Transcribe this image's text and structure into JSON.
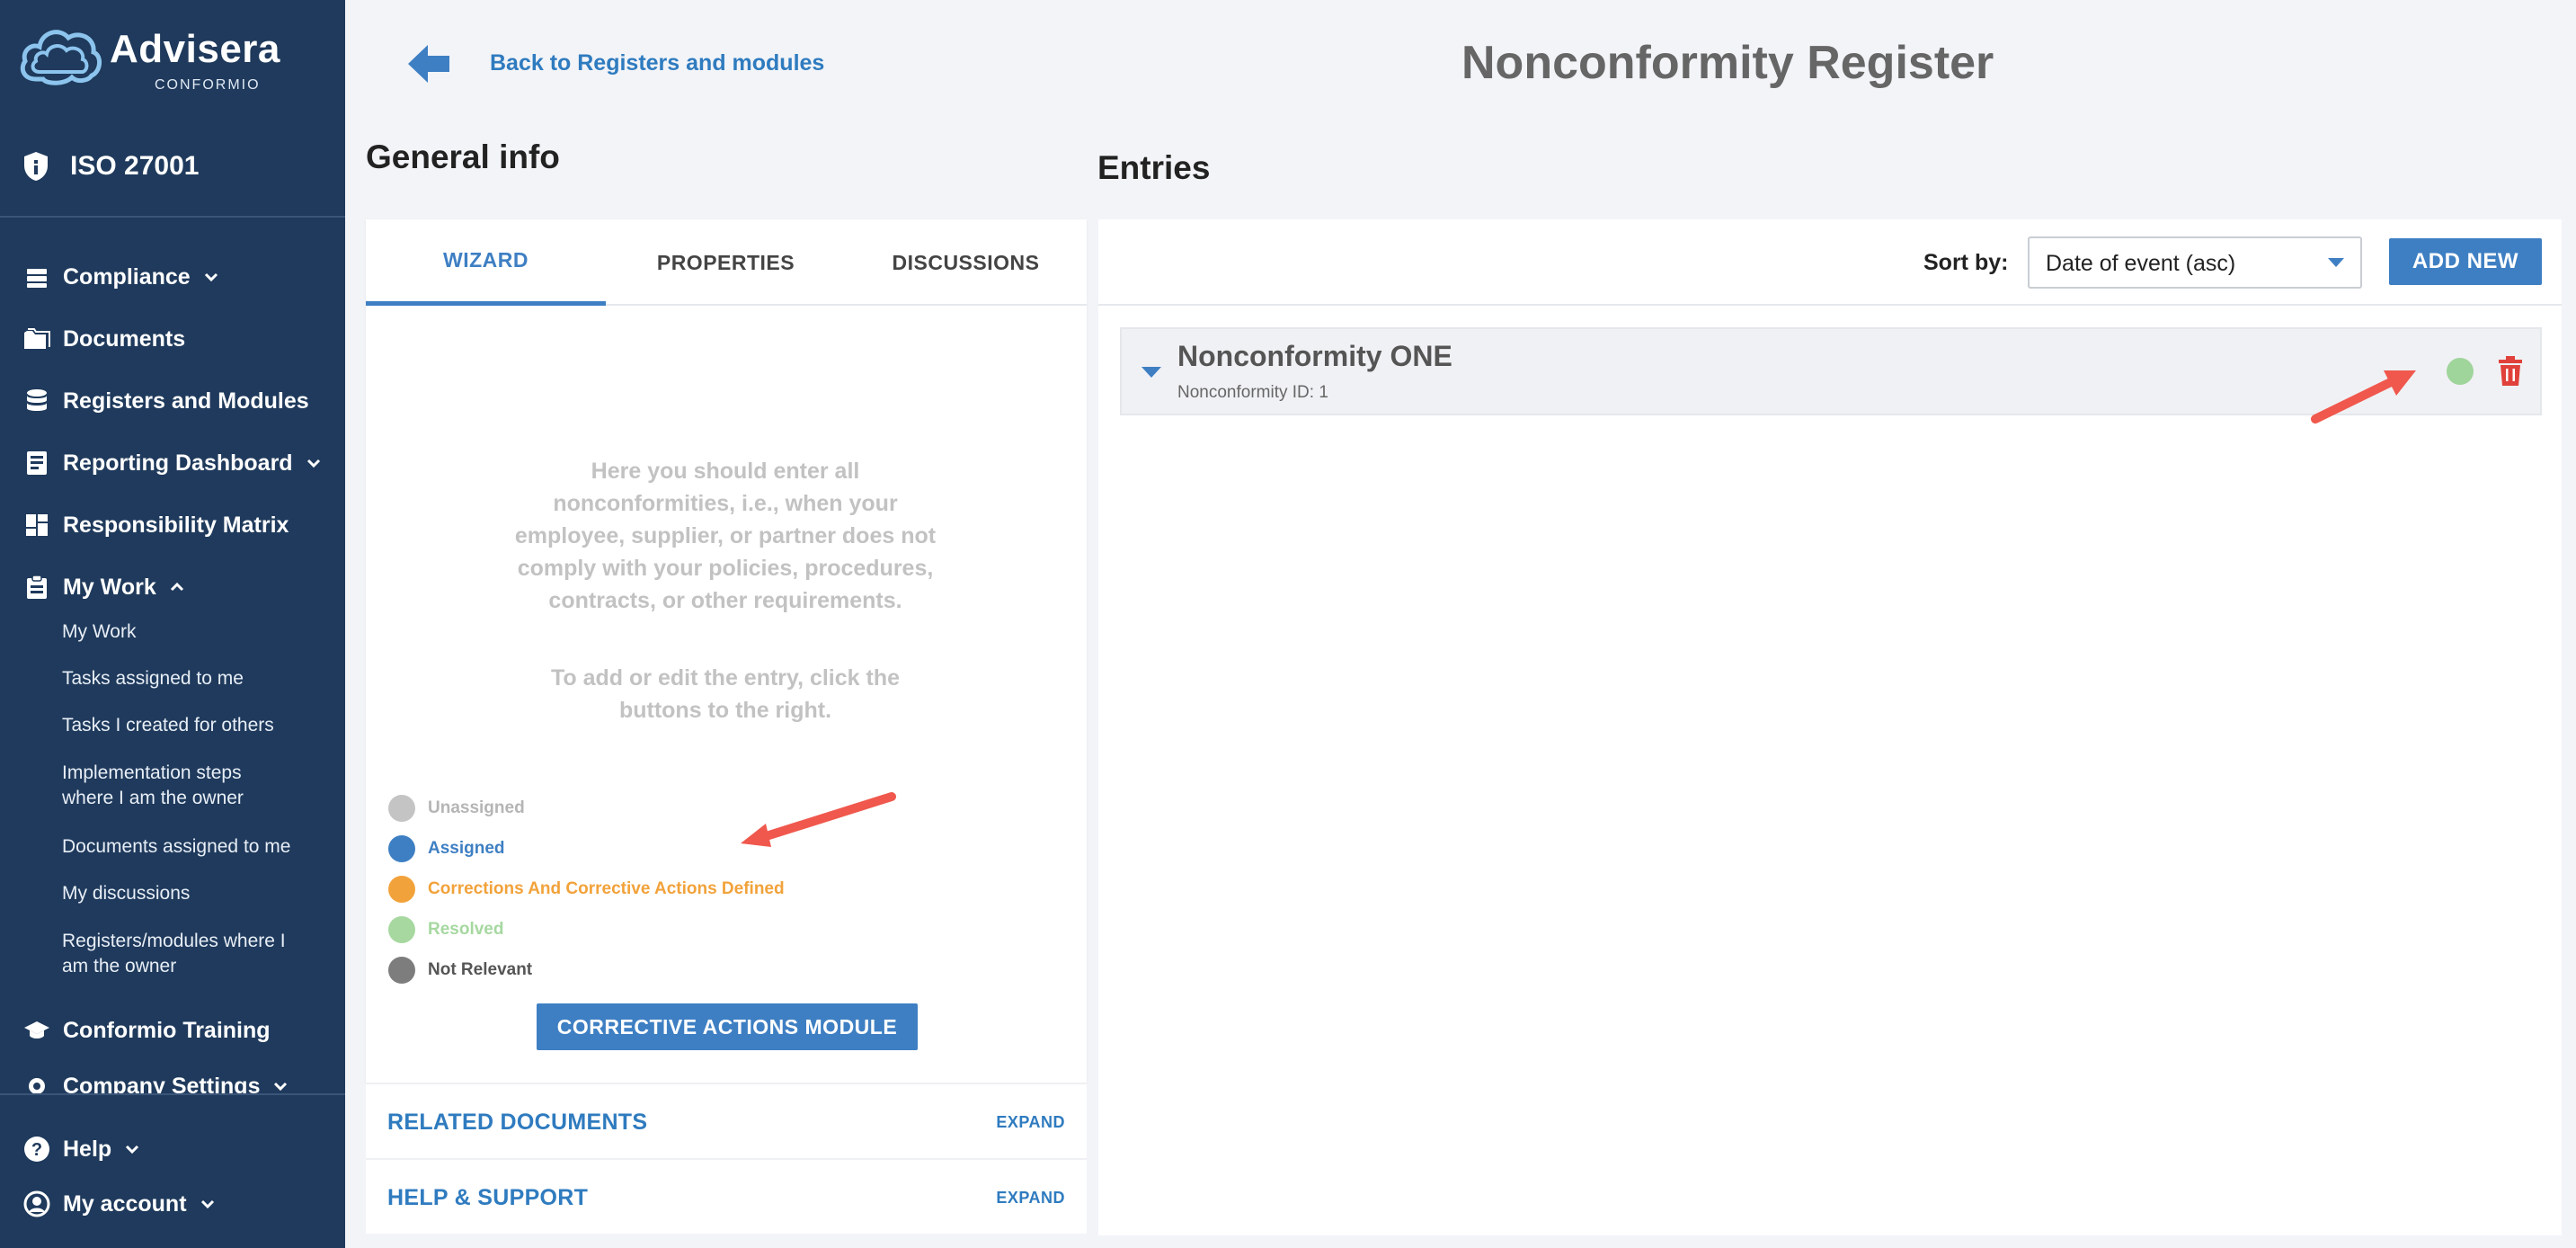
{
  "brand": {
    "name": "Advisera",
    "sub": "CONFORMIO"
  },
  "project": {
    "label": "ISO 27001"
  },
  "nav": {
    "compliance": "Compliance",
    "documents": "Documents",
    "registers": "Registers and Modules",
    "reporting": "Reporting Dashboard",
    "responsibility": "Responsibility Matrix",
    "my_work": "My Work",
    "sub_items": [
      "My Work",
      "Tasks assigned to me",
      "Tasks I created for others",
      "Implementation steps where I am the owner",
      "Documents assigned to me",
      "My discussions",
      "Registers/modules where I am the owner"
    ],
    "training": "Conformio Training",
    "company_settings": "Company Settings",
    "help": "Help",
    "account": "My account"
  },
  "header": {
    "back_label": "Back to Registers and modules",
    "title": "Nonconformity Register"
  },
  "general_info": {
    "title": "General info",
    "tabs": [
      "WIZARD",
      "PROPERTIES",
      "DISCUSSIONS"
    ],
    "active_tab": "WIZARD",
    "description": "Here you should enter all nonconformities, i.e., when your employee, supplier, or partner does not comply with your policies, procedures, contracts, or other requirements.",
    "instruction": "To add or edit the entry, click the buttons to the right.",
    "legend": [
      {
        "label": "Unassigned",
        "color": "#c4c4c4"
      },
      {
        "label": "Assigned",
        "color": "#3e7fc3"
      },
      {
        "label": "Corrections And Corrective Actions Defined",
        "color": "#f2a23a"
      },
      {
        "label": "Resolved",
        "color": "#a6d8a0"
      },
      {
        "label": "Not Relevant",
        "color": "#7d7d7d"
      }
    ],
    "corrective_button": "CORRECTIVE ACTIONS MODULE"
  },
  "accordions": [
    {
      "title": "RELATED DOCUMENTS",
      "action": "EXPAND"
    },
    {
      "title": "HELP & SUPPORT",
      "action": "EXPAND"
    }
  ],
  "entries": {
    "title": "Entries",
    "sort_label": "Sort by:",
    "sort_value": "Date of event (asc)",
    "add_new": "ADD NEW",
    "items": [
      {
        "title": "Nonconformity ONE",
        "subtitle": "Nonconformity ID: 1",
        "status": "Resolved"
      }
    ]
  },
  "colors": {
    "sidebar": "#1f3a5c",
    "accent": "#3e7fc3",
    "link": "#2f7bbf",
    "annotation": "#f0584d",
    "delete": "#e0413a"
  }
}
